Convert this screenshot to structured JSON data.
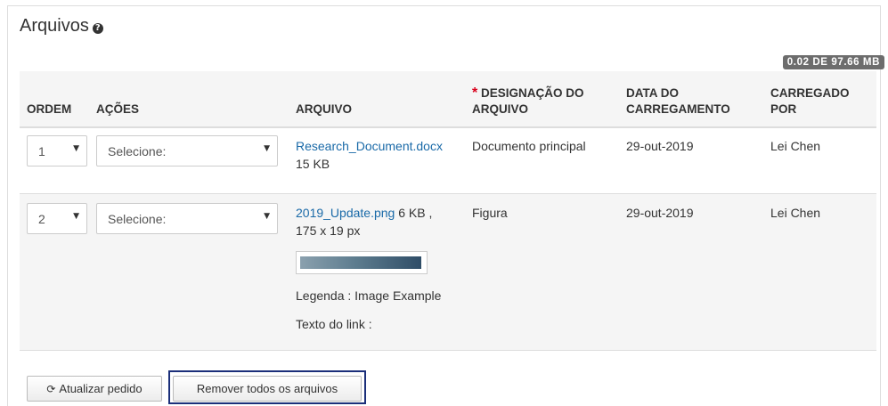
{
  "panel": {
    "title": "Arquivos",
    "help_icon": "?",
    "quota": "0.02 DE 97.66 MB"
  },
  "table": {
    "headers": {
      "order": "ORDEM",
      "actions": "AÇÕES",
      "file": "ARQUIVO",
      "required_mark": "*",
      "designation_1": "DESIGNAÇÃO DO",
      "designation_2": "ARQUIVO",
      "date_1": "DATA DO",
      "date_2": "CARREGAMENTO",
      "uploader_1": "CARREGADO",
      "uploader_2": "POR"
    },
    "rows": [
      {
        "order": "1",
        "action_placeholder": "Selecione:",
        "file_name": "Research_Document.docx",
        "file_meta_1": "",
        "file_meta_2": "15 KB",
        "designation": "Documento principal",
        "date": "29-out-2019",
        "uploader": "Lei Chen"
      },
      {
        "order": "2",
        "action_placeholder": "Selecione:",
        "file_name": "2019_Update.png",
        "file_meta_1": " 6 KB ,",
        "file_meta_2": "175 x 19 px",
        "caption": "Legenda : Image Example",
        "link_text": "Texto do link :",
        "designation": "Figura",
        "date": "29-out-2019",
        "uploader": "Lei Chen"
      }
    ]
  },
  "buttons": {
    "refresh_order": "Atualizar pedido",
    "remove_all": "Remover todos os arquivos"
  },
  "colors": {
    "link": "#1a6aa8",
    "quota_badge": "#6d6d6d",
    "required": "#d9001b",
    "focus_ring": "#1b2f7a"
  }
}
